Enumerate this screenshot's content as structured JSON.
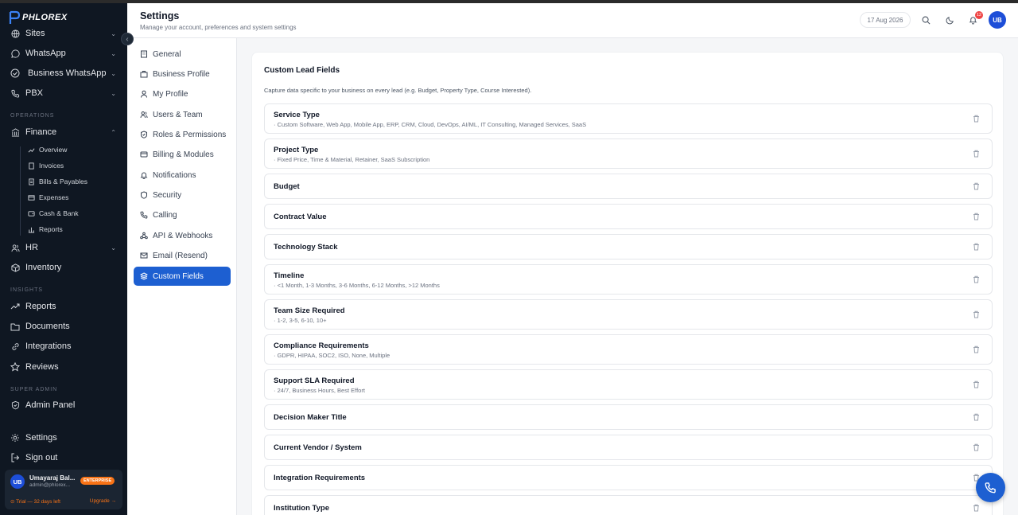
{
  "brand": {
    "name": "PHLOREX"
  },
  "sidebar": {
    "items_top": [
      {
        "label": "Sites",
        "icon": "globe-icon"
      },
      {
        "label": "WhatsApp",
        "icon": "chat-icon"
      },
      {
        "label": "Business WhatsApp",
        "icon": "check-circle-icon"
      },
      {
        "label": "PBX",
        "icon": "phone-icon"
      }
    ],
    "operations_label": "OPERATIONS",
    "finance_label": "Finance",
    "finance_sub": [
      {
        "label": "Overview",
        "icon": "trend-icon"
      },
      {
        "label": "Invoices",
        "icon": "document-icon"
      },
      {
        "label": "Bills & Payables",
        "icon": "document-icon"
      },
      {
        "label": "Expenses",
        "icon": "card-icon"
      },
      {
        "label": "Cash & Bank",
        "icon": "wallet-icon"
      },
      {
        "label": "Reports",
        "icon": "bar-chart-icon"
      }
    ],
    "hr_label": "HR",
    "inventory_label": "Inventory",
    "insights_label": "INSIGHTS",
    "insights_items": [
      {
        "label": "Reports",
        "icon": "trend-icon"
      },
      {
        "label": "Documents",
        "icon": "folder-icon"
      },
      {
        "label": "Integrations",
        "icon": "link-icon"
      },
      {
        "label": "Reviews",
        "icon": "star-icon"
      }
    ],
    "super_admin_label": "SUPER ADMIN",
    "admin_panel_label": "Admin Panel",
    "settings_label": "Settings",
    "signout_label": "Sign out",
    "user": {
      "initials": "UB",
      "name": "Umayaraj Bal...",
      "email": "admin@phlorex...",
      "plan_badge": "ENTERPRISE",
      "trial_text": "⊙ Trial — 32 days left",
      "upgrade_text": "Upgrade →"
    }
  },
  "header": {
    "title": "Settings",
    "subtitle": "Manage your account, preferences and system settings",
    "date": "17 Aug 2026",
    "notification_count": "12",
    "avatar_initials": "UB"
  },
  "settings_nav": [
    {
      "label": "General",
      "icon": "building-icon"
    },
    {
      "label": "Business Profile",
      "icon": "briefcase-icon"
    },
    {
      "label": "My Profile",
      "icon": "user-icon"
    },
    {
      "label": "Users & Team",
      "icon": "users-icon"
    },
    {
      "label": "Roles & Permissions",
      "icon": "shield-icon"
    },
    {
      "label": "Billing & Modules",
      "icon": "card-icon"
    },
    {
      "label": "Notifications",
      "icon": "bell-icon"
    },
    {
      "label": "Security",
      "icon": "shield-icon"
    },
    {
      "label": "Calling",
      "icon": "phone-icon"
    },
    {
      "label": "API & Webhooks",
      "icon": "webhook-icon"
    },
    {
      "label": "Email (Resend)",
      "icon": "mail-icon"
    },
    {
      "label": "Custom Fields",
      "icon": "layers-icon",
      "active": true
    }
  ],
  "custom_fields": {
    "title": "Custom Lead Fields",
    "description": "Capture data specific to your business on every lead (e.g. Budget, Property Type, Course Interested).",
    "fields": [
      {
        "name": "Service Type",
        "options": "· Custom Software, Web App, Mobile App, ERP, CRM, Cloud, DevOps, AI/ML, IT Consulting, Managed Services, SaaS"
      },
      {
        "name": "Project Type",
        "options": "· Fixed Price, Time & Material, Retainer, SaaS Subscription"
      },
      {
        "name": "Budget",
        "options": ""
      },
      {
        "name": "Contract Value",
        "options": ""
      },
      {
        "name": "Technology Stack",
        "options": ""
      },
      {
        "name": "Timeline",
        "options": "· <1 Month, 1-3 Months, 3-6 Months, 6-12 Months, >12 Months"
      },
      {
        "name": "Team Size Required",
        "options": "· 1-2, 3-5, 6-10, 10+"
      },
      {
        "name": "Compliance Requirements",
        "options": "· GDPR, HIPAA, SOC2, ISO, None, Multiple"
      },
      {
        "name": "Support SLA Required",
        "options": "· 24/7, Business Hours, Best Effort"
      },
      {
        "name": "Decision Maker Title",
        "options": ""
      },
      {
        "name": "Current Vendor / System",
        "options": ""
      },
      {
        "name": "Integration Requirements",
        "options": ""
      },
      {
        "name": "Institution Type",
        "options": ""
      }
    ]
  },
  "colors": {
    "accent": "#1d5fd1",
    "sidebar_bg": "#0f1722",
    "badge": "#f97316",
    "notif": "#ef4444"
  }
}
